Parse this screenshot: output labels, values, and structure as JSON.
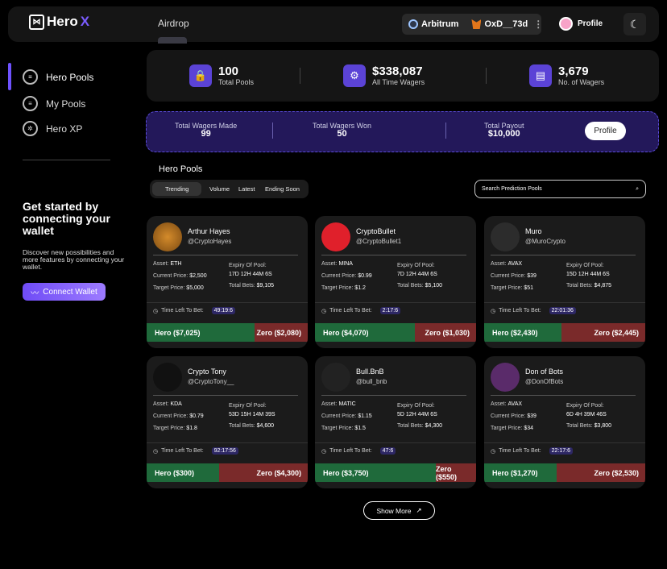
{
  "header": {
    "logo": "Hero",
    "logo_x": "X",
    "nav_airdrop": "Airdrop",
    "network": "Arbitrum",
    "wallet": "OxD__73d",
    "profile": "Profile"
  },
  "sidebar": {
    "items": [
      {
        "label": "Hero Pools"
      },
      {
        "label": "My Pools"
      },
      {
        "label": "Hero XP"
      }
    ],
    "cta_title": "Get started by connecting your wallet",
    "cta_desc": "Discover new possibilities and more features by connecting your wallet.",
    "connect": "Connect Wallet"
  },
  "stats": [
    {
      "value": "100",
      "label": "Total Pools"
    },
    {
      "value": "$338,087",
      "label": "All Time Wagers"
    },
    {
      "value": "3,679",
      "label": "No. of Wagers"
    }
  ],
  "banner": {
    "items": [
      {
        "label": "Total Wagers Made",
        "value": "99"
      },
      {
        "label": "Total Wagers Won",
        "value": "50"
      },
      {
        "label": "Total Payout",
        "value": "$10,000"
      }
    ],
    "button": "Profile"
  },
  "pools": {
    "title": "Hero Pools",
    "tabs": [
      "Trending",
      "Volume",
      "Latest",
      "Ending Soon"
    ],
    "search_placeholder": "Search Prediction Pools",
    "show_more": "Show More"
  },
  "labels": {
    "asset": "Asset:",
    "current": "Current Price:",
    "target": "Target Price:",
    "expiry": "Expiry Of Pool:",
    "bets": "Total Bets:",
    "time_left": "Time Left To Bet:"
  },
  "cards": [
    {
      "name": "Arthur Hayes",
      "handle": "@CryptoHayes",
      "asset": "ETH",
      "current": "$2,500",
      "target": "$5,000",
      "expiry": "17D 12H 44M 6S",
      "bets": "$9,105",
      "time": "49:19:6",
      "hero": "Hero ($7,025)",
      "zero": "Zero ($2,080)",
      "hero_share": 0.67
    },
    {
      "name": "CryptoBullet",
      "handle": "@CryptoBullet1",
      "asset": "MINA",
      "current": "$0.99",
      "target": "$1.2",
      "expiry": "7D 12H 44M 6S",
      "bets": "$5,100",
      "time": "2:17:6",
      "hero": "Hero ($4,070)",
      "zero": "Zero ($1,030)",
      "hero_share": 0.62
    },
    {
      "name": "Muro",
      "handle": "@MuroCrypto",
      "asset": "AVAX",
      "current": "$39",
      "target": "$51",
      "expiry": "15D 12H 44M 6S",
      "bets": "$4,875",
      "time": "22:01:36",
      "hero": "Hero ($2,430)",
      "zero": "Zero ($2,445)",
      "hero_share": 0.48
    },
    {
      "name": "Crypto Tony",
      "handle": "@CryptoTony__",
      "asset": "KDA",
      "current": "$0.79",
      "target": "$1.8",
      "expiry": "53D 15H 14M 39S",
      "bets": "$4,600",
      "time": "92:17:56",
      "hero": "Hero ($300)",
      "zero": "Zero ($4,300)",
      "hero_share": 0.45
    },
    {
      "name": "Bull.BnB",
      "handle": "@bull_bnb",
      "asset": "MATIC",
      "current": "$1.15",
      "target": "$1.5",
      "expiry": "5D 12H 44M 6S",
      "bets": "$4,300",
      "time": "47:6",
      "hero": "Hero ($3,750)",
      "zero": "Zero ($550)",
      "hero_share": 0.75
    },
    {
      "name": "Don of Bots",
      "handle": "@DonOfBots",
      "asset": "AVAX",
      "current": "$39",
      "target": "$34",
      "expiry": "6D 4H 39M 46S",
      "bets": "$3,800",
      "time": "22:17:6",
      "hero": "Hero ($1,270)",
      "zero": "Zero ($2,530)",
      "hero_share": 0.45
    }
  ]
}
